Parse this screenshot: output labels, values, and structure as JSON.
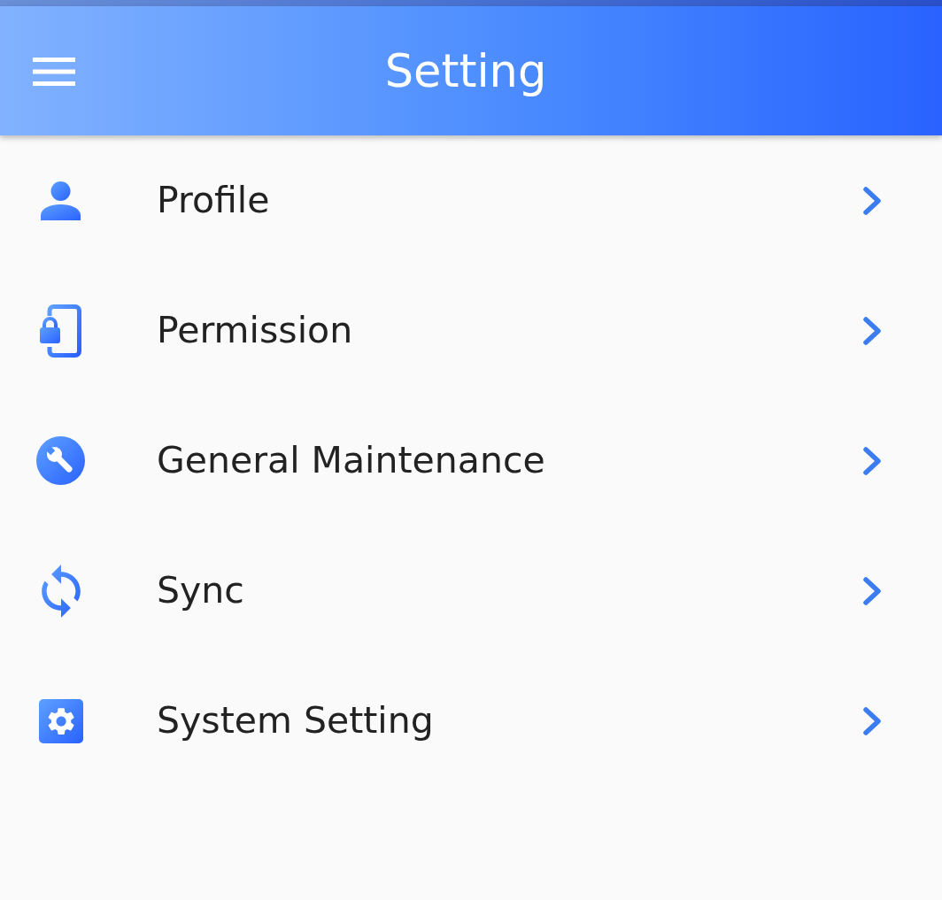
{
  "app_bar": {
    "title": "Setting"
  },
  "menu": [
    {
      "label": "Profile"
    },
    {
      "label": "Permission"
    },
    {
      "label": "General Maintenance"
    },
    {
      "label": "Sync"
    },
    {
      "label": "System Setting"
    }
  ]
}
